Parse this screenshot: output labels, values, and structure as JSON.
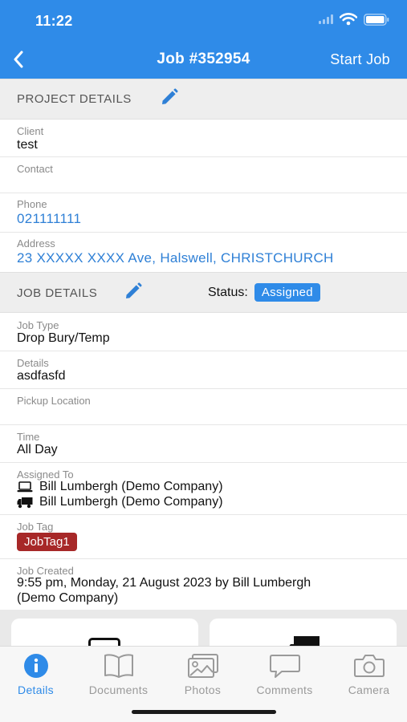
{
  "status_bar": {
    "time": "11:22"
  },
  "header": {
    "title": "Job #352954",
    "action": "Start Job"
  },
  "project_section": {
    "label": "PROJECT DETAILS",
    "fields": {
      "client": {
        "label": "Client",
        "value": "test"
      },
      "contact": {
        "label": "Contact",
        "value": ""
      },
      "phone": {
        "label": "Phone",
        "value": "021111111"
      },
      "address": {
        "label": "Address",
        "value": "23 XXXXX XXXX Ave, Halswell, CHRISTCHURCH"
      }
    }
  },
  "job_section": {
    "label": "JOB DETAILS",
    "status_label": "Status:",
    "status_value": "Assigned",
    "fields": {
      "job_type": {
        "label": "Job Type",
        "value": "Drop Bury/Temp"
      },
      "details": {
        "label": "Details",
        "value": "asdfasfd"
      },
      "pickup": {
        "label": "Pickup Location",
        "value": ""
      },
      "time": {
        "label": "Time",
        "value": "All Day"
      },
      "assigned": {
        "label": "Assigned To",
        "computer_value": "Bill Lumbergh (Demo Company)",
        "truck_value": "Bill Lumbergh (Demo Company)"
      },
      "job_tag": {
        "label": "Job Tag",
        "value": "JobTag1"
      },
      "job_created": {
        "label": "Job Created",
        "line1": "9:55 pm, Monday, 21 August 2023 by Bill Lumbergh",
        "line2": "(Demo Company)"
      }
    }
  },
  "tabs": [
    {
      "label": "Details",
      "icon": "info-icon",
      "active": true
    },
    {
      "label": "Documents",
      "icon": "book-icon",
      "active": false
    },
    {
      "label": "Photos",
      "icon": "photos-icon",
      "active": false
    },
    {
      "label": "Comments",
      "icon": "comment-icon",
      "active": false
    },
    {
      "label": "Camera",
      "icon": "camera-icon",
      "active": false
    }
  ],
  "colors": {
    "header_blue": "#2f8be8",
    "link_blue": "#2f80d6",
    "tag_red": "#a72828",
    "section_gray": "#eeeeee"
  }
}
